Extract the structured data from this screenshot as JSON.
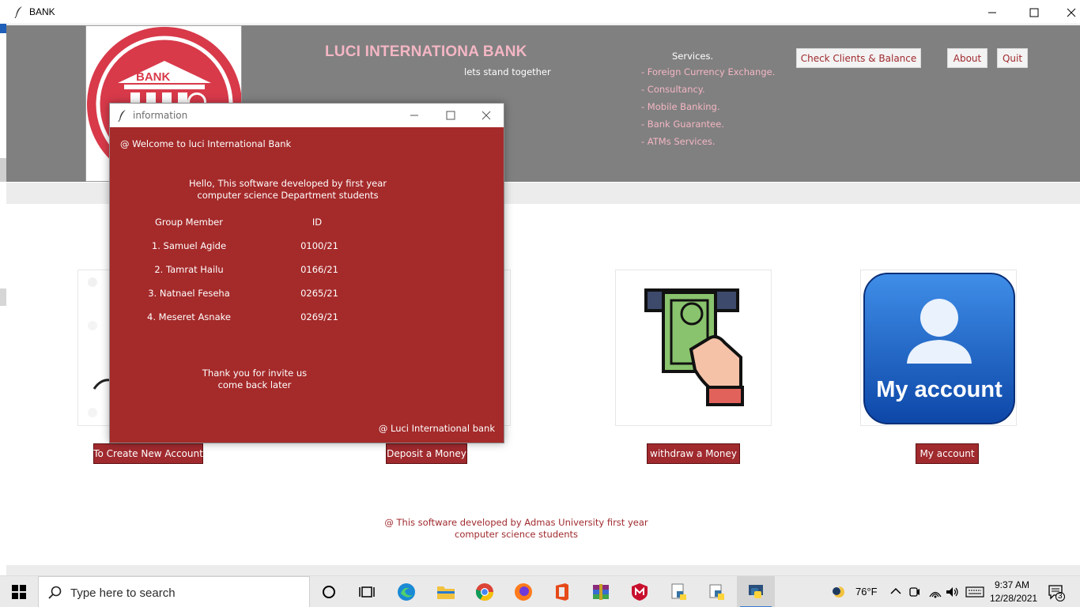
{
  "window": {
    "title": "BANK"
  },
  "header": {
    "logo_text": "BANK",
    "bank_name": "LUCI INTERNATIONA BANK",
    "tagline": "lets stand together",
    "services_heading": "Services.",
    "services": [
      "-  Foreign Currency Exchange.",
      "-  Consultancy.",
      "-  Mobile Banking.",
      "-  Bank Guarantee.",
      "-  ATMs Services."
    ],
    "buttons": {
      "check_clients": "Check Clients & Balance",
      "about": "About",
      "quit": "Quit"
    }
  },
  "actions": {
    "create_account": "To Create New Account",
    "deposit": "Deposit a Money",
    "withdraw": "withdraw a Money",
    "my_account": "My account",
    "my_account_tile_text": "My account"
  },
  "footer": {
    "line1": "@ This software developed by Admas University first year",
    "line2": "computer science students"
  },
  "dialog": {
    "title": "information",
    "welcome": "@  Welcome to luci International Bank",
    "intro_line1": "Hello, This software developed by first year",
    "intro_line2": "computer science Department students",
    "col_member": "Group Member",
    "col_id": "ID",
    "members": [
      {
        "name": "1. Samuel Agide",
        "id": "0100/21"
      },
      {
        "name": "2. Tamrat Hailu",
        "id": "0166/21"
      },
      {
        "name": "3. Natnael Feseha",
        "id": "0265/21"
      },
      {
        "name": "4. Meseret Asnake",
        "id": "0269/21"
      }
    ],
    "thanks_line1": "Thank you for invite us",
    "thanks_line2": "come back later",
    "signature": "@ Luci International bank"
  },
  "taskbar": {
    "search_placeholder": "Type here to search",
    "weather": "76°F",
    "time": "9:37 AM",
    "date": "12/28/2021",
    "notification_count": "3"
  },
  "colors": {
    "brand_red": "#a52a2a",
    "header_gray": "#808080",
    "title_pink": "#f4b6c4"
  }
}
